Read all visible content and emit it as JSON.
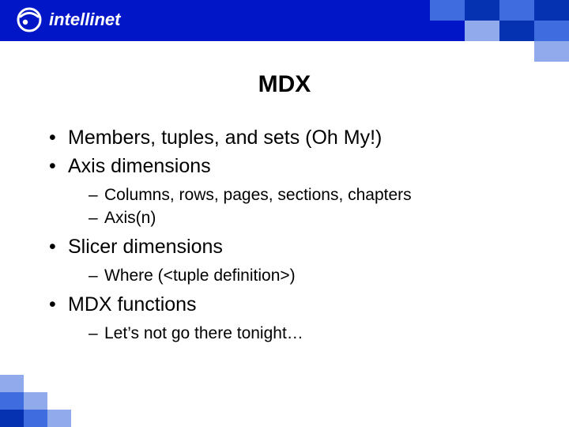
{
  "brand": {
    "name": "intellinet"
  },
  "colors": {
    "brand_blue": "#0016c7",
    "mosaic_dark": "#0432b0",
    "mosaic_mid": "#3f6de0",
    "mosaic_light": "#91aaeb"
  },
  "slide": {
    "title": "MDX",
    "bullets": [
      {
        "text": "Members, tuples, and sets (Oh My!)",
        "children": []
      },
      {
        "text": "Axis dimensions",
        "children": [
          {
            "text": "Columns, rows, pages, sections, chapters"
          },
          {
            "text": "Axis(n)"
          }
        ]
      },
      {
        "text": "Slicer dimensions",
        "children": [
          {
            "text": "Where (<tuple definition>)"
          }
        ]
      },
      {
        "text": "MDX functions",
        "children": [
          {
            "text": "Let’s not go there tonight…"
          }
        ]
      }
    ]
  }
}
